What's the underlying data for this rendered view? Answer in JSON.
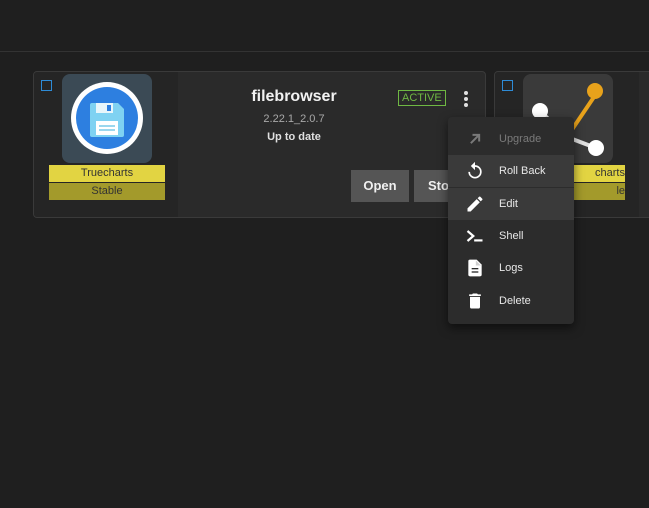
{
  "app_card": {
    "name": "filebrowser",
    "version": "2.22.1_2.0.7",
    "update_status": "Up to date",
    "status": "ACTIVE",
    "train": "Truecharts",
    "channel": "Stable",
    "open_label": "Open",
    "stop_label": "Sto",
    "icon": "floppy-disk-icon"
  },
  "second_card": {
    "train": "charts",
    "channel": "le",
    "icon": "git-branch-icon"
  },
  "context_menu": {
    "items": [
      {
        "label": "Upgrade",
        "icon": "arrow-up-right-icon",
        "disabled": true
      },
      {
        "label": "Roll Back",
        "icon": "rollback-icon",
        "disabled": false
      },
      {
        "label": "Edit",
        "icon": "pencil-icon",
        "disabled": false
      },
      {
        "label": "Shell",
        "icon": "terminal-icon",
        "disabled": false
      },
      {
        "label": "Logs",
        "icon": "document-icon",
        "disabled": false
      },
      {
        "label": "Delete",
        "icon": "trash-icon",
        "disabled": false
      }
    ]
  },
  "colors": {
    "background": "#1f1f1f",
    "card": "#2a2a2a",
    "accent_blue": "#2e8bd6",
    "active_green": "#6fb843",
    "train_yellow": "#e2d442",
    "channel_olive": "#a39a2b"
  }
}
